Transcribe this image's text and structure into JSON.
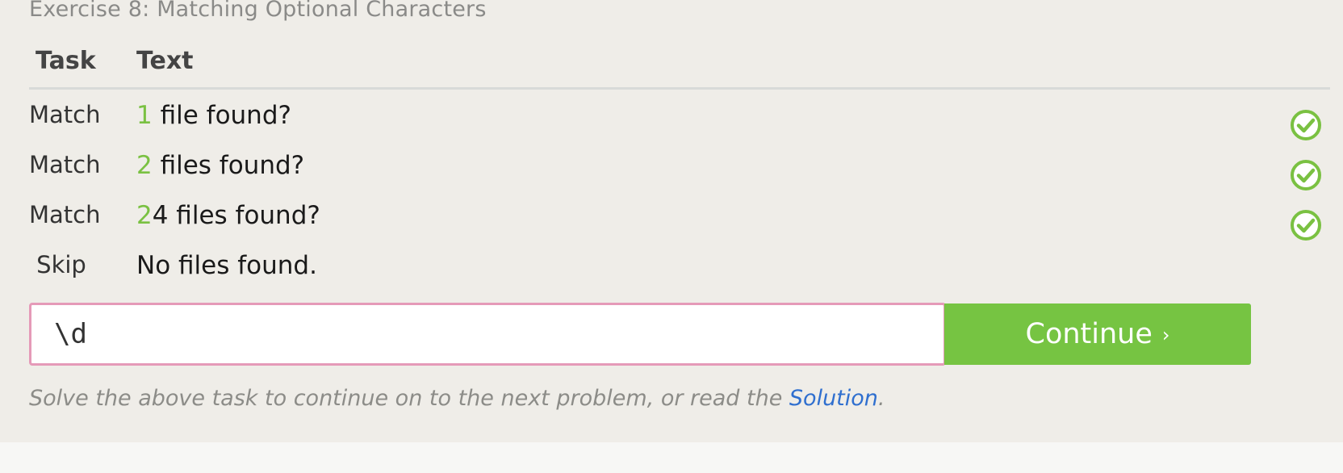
{
  "exercise": {
    "title": "Exercise 8: Matching Optional Characters"
  },
  "table": {
    "headers": {
      "task": "Task",
      "text": "Text"
    },
    "rows": [
      {
        "task": "Match",
        "highlight": "1",
        "rest": " file found?",
        "status": "passed"
      },
      {
        "task": "Match",
        "highlight": "2",
        "rest": " files found?",
        "status": "passed"
      },
      {
        "task": "Match",
        "highlight": "2",
        "rest": "4 files found?",
        "status": "passed"
      },
      {
        "task": "Skip",
        "highlight": "",
        "rest": "No files found.",
        "status": "none"
      }
    ]
  },
  "input": {
    "value": "\\d"
  },
  "continue_button": {
    "label": "Continue",
    "arrow": "›"
  },
  "hint": {
    "prefix": "Solve the above task to continue on to the next problem, or read the ",
    "link": "Solution",
    "suffix": "."
  },
  "colors": {
    "match_highlight": "#7ac142",
    "continue_button": "#76c442",
    "input_border": "#e59ab8",
    "link": "#2f6fcf"
  },
  "icons": {
    "check": "check-circle-icon"
  }
}
